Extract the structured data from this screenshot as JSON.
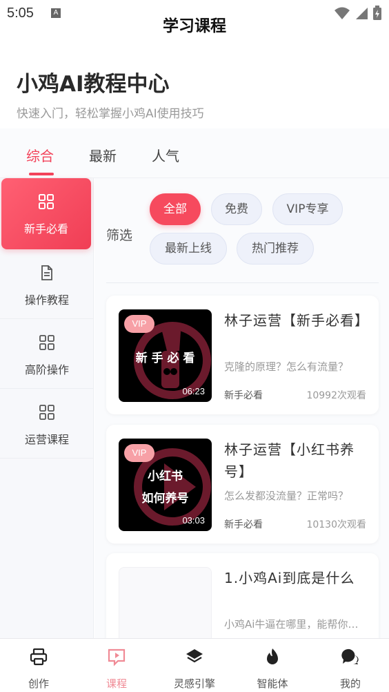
{
  "status": {
    "time": "5:05",
    "notif_glyph": "A"
  },
  "nav": {
    "title": "学习课程"
  },
  "hero": {
    "title": "小鸡AI教程中心",
    "subtitle": "快速入门，轻松掌握小鸡AI使用技巧"
  },
  "tabs": [
    {
      "label": "综合"
    },
    {
      "label": "最新"
    },
    {
      "label": "人气"
    }
  ],
  "sidebar": {
    "items": [
      {
        "label": "新手必看",
        "icon": "grid-icon"
      },
      {
        "label": "操作教程",
        "icon": "document-icon"
      },
      {
        "label": "高阶操作",
        "icon": "grid-icon"
      },
      {
        "label": "运营课程",
        "icon": "grid-icon"
      }
    ]
  },
  "filter": {
    "label": "筛选",
    "chips": [
      {
        "label": "全部"
      },
      {
        "label": "免费"
      },
      {
        "label": "VIP专享"
      },
      {
        "label": "最新上线"
      },
      {
        "label": "热门推荐"
      }
    ]
  },
  "courses": [
    {
      "badge": "VIP",
      "thumb_lines": [
        "新 手 必 看"
      ],
      "duration": "06:23",
      "title": "林子运营【新手必看】",
      "desc": "克隆的原理？怎么有流量？",
      "category": "新手必看",
      "views": "10992次观看"
    },
    {
      "badge": "VIP",
      "thumb_lines": [
        "小红书",
        "如何养号"
      ],
      "duration": "03:03",
      "title": "林子运营【小红书养号】",
      "desc": "怎么发都没流量？正常吗？",
      "category": "新手必看",
      "views": "10130次观看"
    },
    {
      "title": "1.小鸡Ai到底是什么",
      "desc": "小鸡Ai牛逼在哪里，能帮你做什么"
    }
  ],
  "bottom_nav": [
    {
      "label": "创作",
      "icon": "printer-icon"
    },
    {
      "label": "课程",
      "icon": "video-chat-icon"
    },
    {
      "label": "灵感引擎",
      "icon": "layers-icon"
    },
    {
      "label": "智能体",
      "icon": "flame-icon"
    },
    {
      "label": "我的",
      "icon": "chat-bubbles-icon"
    }
  ],
  "colors": {
    "accent": "#f2435a",
    "accent_light": "#f08a95",
    "vip_badge": "#f7a0a6"
  }
}
